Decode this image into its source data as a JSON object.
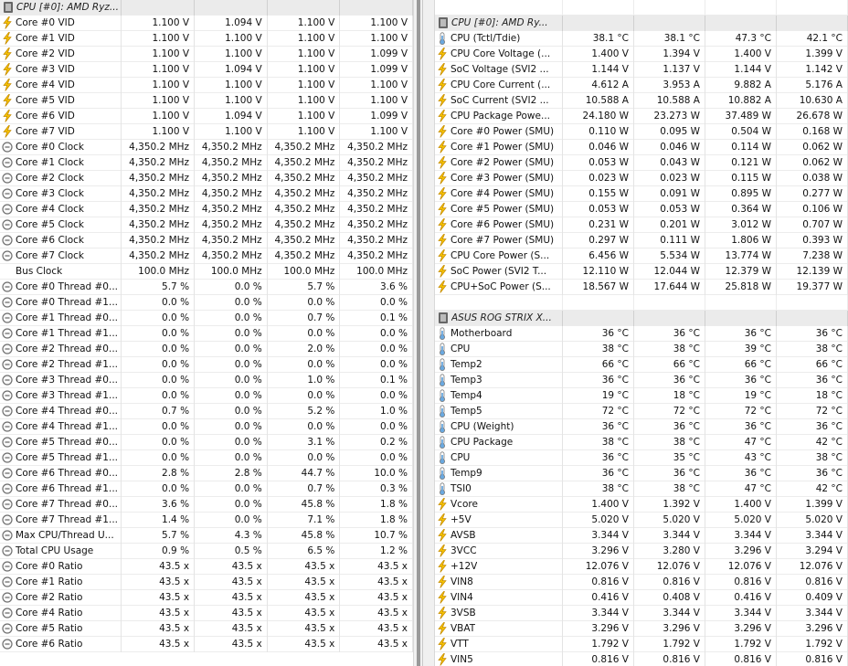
{
  "colors": {
    "bolt": "#f4c000",
    "bolt_stroke": "#c48a00",
    "clock": "#6f6f6f",
    "thermo_fill": "#6aa9e0",
    "thermo_stroke": "#7a7a7a",
    "header_bg": "#ebebeb"
  },
  "left_panel": {
    "header": "CPU [#0]: AMD Ryz...",
    "rows": [
      {
        "icon": "bolt-icon",
        "label": "Core #0 VID",
        "values": [
          "1.100 V",
          "1.094 V",
          "1.100 V",
          "1.100 V"
        ]
      },
      {
        "icon": "bolt-icon",
        "label": "Core #1 VID",
        "values": [
          "1.100 V",
          "1.100 V",
          "1.100 V",
          "1.100 V"
        ]
      },
      {
        "icon": "bolt-icon",
        "label": "Core #2 VID",
        "values": [
          "1.100 V",
          "1.100 V",
          "1.100 V",
          "1.099 V"
        ]
      },
      {
        "icon": "bolt-icon",
        "label": "Core #3 VID",
        "values": [
          "1.100 V",
          "1.094 V",
          "1.100 V",
          "1.099 V"
        ]
      },
      {
        "icon": "bolt-icon",
        "label": "Core #4 VID",
        "values": [
          "1.100 V",
          "1.100 V",
          "1.100 V",
          "1.100 V"
        ]
      },
      {
        "icon": "bolt-icon",
        "label": "Core #5 VID",
        "values": [
          "1.100 V",
          "1.100 V",
          "1.100 V",
          "1.100 V"
        ]
      },
      {
        "icon": "bolt-icon",
        "label": "Core #6 VID",
        "values": [
          "1.100 V",
          "1.094 V",
          "1.100 V",
          "1.099 V"
        ]
      },
      {
        "icon": "bolt-icon",
        "label": "Core #7 VID",
        "values": [
          "1.100 V",
          "1.100 V",
          "1.100 V",
          "1.100 V"
        ]
      },
      {
        "icon": "clock-icon",
        "label": "Core #0 Clock",
        "values": [
          "4,350.2 MHz",
          "4,350.2 MHz",
          "4,350.2 MHz",
          "4,350.2 MHz"
        ]
      },
      {
        "icon": "clock-icon",
        "label": "Core #1 Clock",
        "values": [
          "4,350.2 MHz",
          "4,350.2 MHz",
          "4,350.2 MHz",
          "4,350.2 MHz"
        ]
      },
      {
        "icon": "clock-icon",
        "label": "Core #2 Clock",
        "values": [
          "4,350.2 MHz",
          "4,350.2 MHz",
          "4,350.2 MHz",
          "4,350.2 MHz"
        ]
      },
      {
        "icon": "clock-icon",
        "label": "Core #3 Clock",
        "values": [
          "4,350.2 MHz",
          "4,350.2 MHz",
          "4,350.2 MHz",
          "4,350.2 MHz"
        ]
      },
      {
        "icon": "clock-icon",
        "label": "Core #4 Clock",
        "values": [
          "4,350.2 MHz",
          "4,350.2 MHz",
          "4,350.2 MHz",
          "4,350.2 MHz"
        ]
      },
      {
        "icon": "clock-icon",
        "label": "Core #5 Clock",
        "values": [
          "4,350.2 MHz",
          "4,350.2 MHz",
          "4,350.2 MHz",
          "4,350.2 MHz"
        ]
      },
      {
        "icon": "clock-icon",
        "label": "Core #6 Clock",
        "values": [
          "4,350.2 MHz",
          "4,350.2 MHz",
          "4,350.2 MHz",
          "4,350.2 MHz"
        ]
      },
      {
        "icon": "clock-icon",
        "label": "Core #7 Clock",
        "values": [
          "4,350.2 MHz",
          "4,350.2 MHz",
          "4,350.2 MHz",
          "4,350.2 MHz"
        ]
      },
      {
        "icon": "none",
        "label": "Bus Clock",
        "values": [
          "100.0 MHz",
          "100.0 MHz",
          "100.0 MHz",
          "100.0 MHz"
        ]
      },
      {
        "icon": "clock-icon",
        "label": "Core #0 Thread #0...",
        "values": [
          "5.7 %",
          "0.0 %",
          "5.7 %",
          "3.6 %"
        ]
      },
      {
        "icon": "clock-icon",
        "label": "Core #0 Thread #1...",
        "values": [
          "0.0 %",
          "0.0 %",
          "0.0 %",
          "0.0 %"
        ]
      },
      {
        "icon": "clock-icon",
        "label": "Core #1 Thread #0...",
        "values": [
          "0.0 %",
          "0.0 %",
          "0.7 %",
          "0.1 %"
        ]
      },
      {
        "icon": "clock-icon",
        "label": "Core #1 Thread #1...",
        "values": [
          "0.0 %",
          "0.0 %",
          "0.0 %",
          "0.0 %"
        ]
      },
      {
        "icon": "clock-icon",
        "label": "Core #2 Thread #0...",
        "values": [
          "0.0 %",
          "0.0 %",
          "2.0 %",
          "0.0 %"
        ]
      },
      {
        "icon": "clock-icon",
        "label": "Core #2 Thread #1...",
        "values": [
          "0.0 %",
          "0.0 %",
          "0.0 %",
          "0.0 %"
        ]
      },
      {
        "icon": "clock-icon",
        "label": "Core #3 Thread #0...",
        "values": [
          "0.0 %",
          "0.0 %",
          "1.0 %",
          "0.1 %"
        ]
      },
      {
        "icon": "clock-icon",
        "label": "Core #3 Thread #1...",
        "values": [
          "0.0 %",
          "0.0 %",
          "0.0 %",
          "0.0 %"
        ]
      },
      {
        "icon": "clock-icon",
        "label": "Core #4 Thread #0...",
        "values": [
          "0.7 %",
          "0.0 %",
          "5.2 %",
          "1.0 %"
        ]
      },
      {
        "icon": "clock-icon",
        "label": "Core #4 Thread #1...",
        "values": [
          "0.0 %",
          "0.0 %",
          "0.0 %",
          "0.0 %"
        ]
      },
      {
        "icon": "clock-icon",
        "label": "Core #5 Thread #0...",
        "values": [
          "0.0 %",
          "0.0 %",
          "3.1 %",
          "0.2 %"
        ]
      },
      {
        "icon": "clock-icon",
        "label": "Core #5 Thread #1...",
        "values": [
          "0.0 %",
          "0.0 %",
          "0.0 %",
          "0.0 %"
        ]
      },
      {
        "icon": "clock-icon",
        "label": "Core #6 Thread #0...",
        "values": [
          "2.8 %",
          "2.8 %",
          "44.7 %",
          "10.0 %"
        ]
      },
      {
        "icon": "clock-icon",
        "label": "Core #6 Thread #1...",
        "values": [
          "0.0 %",
          "0.0 %",
          "0.7 %",
          "0.3 %"
        ]
      },
      {
        "icon": "clock-icon",
        "label": "Core #7 Thread #0...",
        "values": [
          "3.6 %",
          "0.0 %",
          "45.8 %",
          "1.8 %"
        ]
      },
      {
        "icon": "clock-icon",
        "label": "Core #7 Thread #1...",
        "values": [
          "1.4 %",
          "0.0 %",
          "7.1 %",
          "1.8 %"
        ]
      },
      {
        "icon": "clock-icon",
        "label": "Max CPU/Thread U...",
        "values": [
          "5.7 %",
          "4.3 %",
          "45.8 %",
          "10.7 %"
        ]
      },
      {
        "icon": "clock-icon",
        "label": "Total CPU Usage",
        "values": [
          "0.9 %",
          "0.5 %",
          "6.5 %",
          "1.2 %"
        ]
      },
      {
        "icon": "clock-icon",
        "label": "Core #0 Ratio",
        "values": [
          "43.5 x",
          "43.5 x",
          "43.5 x",
          "43.5 x"
        ]
      },
      {
        "icon": "clock-icon",
        "label": "Core #1 Ratio",
        "values": [
          "43.5 x",
          "43.5 x",
          "43.5 x",
          "43.5 x"
        ]
      },
      {
        "icon": "clock-icon",
        "label": "Core #2 Ratio",
        "values": [
          "43.5 x",
          "43.5 x",
          "43.5 x",
          "43.5 x"
        ]
      },
      {
        "icon": "clock-icon",
        "label": "Core #4 Ratio",
        "values": [
          "43.5 x",
          "43.5 x",
          "43.5 x",
          "43.5 x"
        ]
      },
      {
        "icon": "clock-icon",
        "label": "Core #5 Ratio",
        "values": [
          "43.5 x",
          "43.5 x",
          "43.5 x",
          "43.5 x"
        ]
      },
      {
        "icon": "clock-icon",
        "label": "Core #6 Ratio",
        "values": [
          "43.5 x",
          "43.5 x",
          "43.5 x",
          "43.5 x"
        ]
      }
    ]
  },
  "right_panel": {
    "cpu_header": "CPU [#0]: AMD Ry...",
    "cpu_rows": [
      {
        "icon": "thermometer-icon",
        "label": "CPU (Tctl/Tdie)",
        "values": [
          "38.1 °C",
          "38.1 °C",
          "47.3 °C",
          "42.1 °C"
        ]
      },
      {
        "icon": "bolt-icon",
        "label": "CPU Core Voltage (...",
        "values": [
          "1.400 V",
          "1.394 V",
          "1.400 V",
          "1.399 V"
        ]
      },
      {
        "icon": "bolt-icon",
        "label": "SoC Voltage (SVI2 ...",
        "values": [
          "1.144 V",
          "1.137 V",
          "1.144 V",
          "1.142 V"
        ]
      },
      {
        "icon": "bolt-icon",
        "label": "CPU Core Current (...",
        "values": [
          "4.612 A",
          "3.953 A",
          "9.882 A",
          "5.176 A"
        ]
      },
      {
        "icon": "bolt-icon",
        "label": "SoC Current (SVI2 ...",
        "values": [
          "10.588 A",
          "10.588 A",
          "10.882 A",
          "10.630 A"
        ]
      },
      {
        "icon": "bolt-icon",
        "label": "CPU Package Powe...",
        "values": [
          "24.180 W",
          "23.273 W",
          "37.489 W",
          "26.678 W"
        ]
      },
      {
        "icon": "bolt-icon",
        "label": "Core #0 Power (SMU)",
        "values": [
          "0.110 W",
          "0.095 W",
          "0.504 W",
          "0.168 W"
        ]
      },
      {
        "icon": "bolt-icon",
        "label": "Core #1 Power (SMU)",
        "values": [
          "0.046 W",
          "0.046 W",
          "0.114 W",
          "0.062 W"
        ]
      },
      {
        "icon": "bolt-icon",
        "label": "Core #2 Power (SMU)",
        "values": [
          "0.053 W",
          "0.043 W",
          "0.121 W",
          "0.062 W"
        ]
      },
      {
        "icon": "bolt-icon",
        "label": "Core #3 Power (SMU)",
        "values": [
          "0.023 W",
          "0.023 W",
          "0.115 W",
          "0.038 W"
        ]
      },
      {
        "icon": "bolt-icon",
        "label": "Core #4 Power (SMU)",
        "values": [
          "0.155 W",
          "0.091 W",
          "0.895 W",
          "0.277 W"
        ]
      },
      {
        "icon": "bolt-icon",
        "label": "Core #5 Power (SMU)",
        "values": [
          "0.053 W",
          "0.053 W",
          "0.364 W",
          "0.106 W"
        ]
      },
      {
        "icon": "bolt-icon",
        "label": "Core #6 Power (SMU)",
        "values": [
          "0.231 W",
          "0.201 W",
          "3.012 W",
          "0.707 W"
        ]
      },
      {
        "icon": "bolt-icon",
        "label": "Core #7 Power (SMU)",
        "values": [
          "0.297 W",
          "0.111 W",
          "1.806 W",
          "0.393 W"
        ]
      },
      {
        "icon": "bolt-icon",
        "label": "CPU Core Power (S...",
        "values": [
          "6.456 W",
          "5.534 W",
          "13.774 W",
          "7.238 W"
        ]
      },
      {
        "icon": "bolt-icon",
        "label": "SoC Power (SVI2 T...",
        "values": [
          "12.110 W",
          "12.044 W",
          "12.379 W",
          "12.139 W"
        ]
      },
      {
        "icon": "bolt-icon",
        "label": "CPU+SoC Power (S...",
        "values": [
          "18.567 W",
          "17.644 W",
          "25.818 W",
          "19.377 W"
        ]
      }
    ],
    "mb_header": "ASUS ROG STRIX X...",
    "mb_rows": [
      {
        "icon": "thermometer-icon",
        "label": "Motherboard",
        "values": [
          "36 °C",
          "36 °C",
          "36 °C",
          "36 °C"
        ]
      },
      {
        "icon": "thermometer-icon",
        "label": "CPU",
        "values": [
          "38 °C",
          "38 °C",
          "39 °C",
          "38 °C"
        ]
      },
      {
        "icon": "thermometer-icon",
        "label": "Temp2",
        "values": [
          "66 °C",
          "66 °C",
          "66 °C",
          "66 °C"
        ]
      },
      {
        "icon": "thermometer-icon",
        "label": "Temp3",
        "values": [
          "36 °C",
          "36 °C",
          "36 °C",
          "36 °C"
        ]
      },
      {
        "icon": "thermometer-icon",
        "label": "Temp4",
        "values": [
          "19 °C",
          "18 °C",
          "19 °C",
          "18 °C"
        ]
      },
      {
        "icon": "thermometer-icon",
        "label": "Temp5",
        "values": [
          "72 °C",
          "72 °C",
          "72 °C",
          "72 °C"
        ]
      },
      {
        "icon": "thermometer-icon",
        "label": "CPU (Weight)",
        "values": [
          "36 °C",
          "36 °C",
          "36 °C",
          "36 °C"
        ]
      },
      {
        "icon": "thermometer-icon",
        "label": "CPU Package",
        "values": [
          "38 °C",
          "38 °C",
          "47 °C",
          "42 °C"
        ]
      },
      {
        "icon": "thermometer-icon",
        "label": "CPU",
        "values": [
          "36 °C",
          "35 °C",
          "43 °C",
          "38 °C"
        ]
      },
      {
        "icon": "thermometer-icon",
        "label": "Temp9",
        "values": [
          "36 °C",
          "36 °C",
          "36 °C",
          "36 °C"
        ]
      },
      {
        "icon": "thermometer-icon",
        "label": "TSI0",
        "values": [
          "38 °C",
          "38 °C",
          "47 °C",
          "42 °C"
        ]
      },
      {
        "icon": "bolt-icon",
        "label": "Vcore",
        "values": [
          "1.400 V",
          "1.392 V",
          "1.400 V",
          "1.399 V"
        ]
      },
      {
        "icon": "bolt-icon",
        "label": "+5V",
        "values": [
          "5.020 V",
          "5.020 V",
          "5.020 V",
          "5.020 V"
        ]
      },
      {
        "icon": "bolt-icon",
        "label": "AVSB",
        "values": [
          "3.344 V",
          "3.344 V",
          "3.344 V",
          "3.344 V"
        ]
      },
      {
        "icon": "bolt-icon",
        "label": "3VCC",
        "values": [
          "3.296 V",
          "3.280 V",
          "3.296 V",
          "3.294 V"
        ]
      },
      {
        "icon": "bolt-icon",
        "label": "+12V",
        "values": [
          "12.076 V",
          "12.076 V",
          "12.076 V",
          "12.076 V"
        ]
      },
      {
        "icon": "bolt-icon",
        "label": "VIN8",
        "values": [
          "0.816 V",
          "0.816 V",
          "0.816 V",
          "0.816 V"
        ]
      },
      {
        "icon": "bolt-icon",
        "label": "VIN4",
        "values": [
          "0.416 V",
          "0.408 V",
          "0.416 V",
          "0.409 V"
        ]
      },
      {
        "icon": "bolt-icon",
        "label": "3VSB",
        "values": [
          "3.344 V",
          "3.344 V",
          "3.344 V",
          "3.344 V"
        ]
      },
      {
        "icon": "bolt-icon",
        "label": "VBAT",
        "values": [
          "3.296 V",
          "3.296 V",
          "3.296 V",
          "3.296 V"
        ]
      },
      {
        "icon": "bolt-icon",
        "label": "VTT",
        "values": [
          "1.792 V",
          "1.792 V",
          "1.792 V",
          "1.792 V"
        ]
      },
      {
        "icon": "bolt-icon",
        "label": "VIN5",
        "values": [
          "0.816 V",
          "0.816 V",
          "0.816 V",
          "0.816 V"
        ]
      }
    ]
  }
}
